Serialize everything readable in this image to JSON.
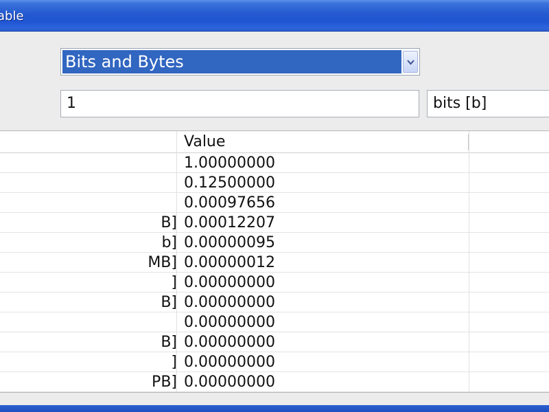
{
  "window": {
    "title": "Table"
  },
  "category_select": {
    "selected": "Bits and Bytes"
  },
  "value_input": {
    "value": "1"
  },
  "unit_select": {
    "selected": "bits [b]"
  },
  "table": {
    "headers": {
      "unit": "",
      "value": "Value"
    },
    "rows": [
      {
        "unit": "",
        "value": "1.00000000"
      },
      {
        "unit": "",
        "value": "0.12500000"
      },
      {
        "unit": "",
        "value": "0.00097656"
      },
      {
        "unit": "B]",
        "value": "0.00012207"
      },
      {
        "unit": "b]",
        "value": "0.00000095"
      },
      {
        "unit": "MB]",
        "value": "0.00000012"
      },
      {
        "unit": "]",
        "value": "0.00000000"
      },
      {
        "unit": "B]",
        "value": "0.00000000"
      },
      {
        "unit": "",
        "value": "0.00000000"
      },
      {
        "unit": "B]",
        "value": "0.00000000"
      },
      {
        "unit": "]",
        "value": "0.00000000"
      },
      {
        "unit": "PB]",
        "value": "0.00000000"
      }
    ]
  },
  "colors": {
    "titlebar": "#2459cf",
    "selection": "#3166c1"
  }
}
